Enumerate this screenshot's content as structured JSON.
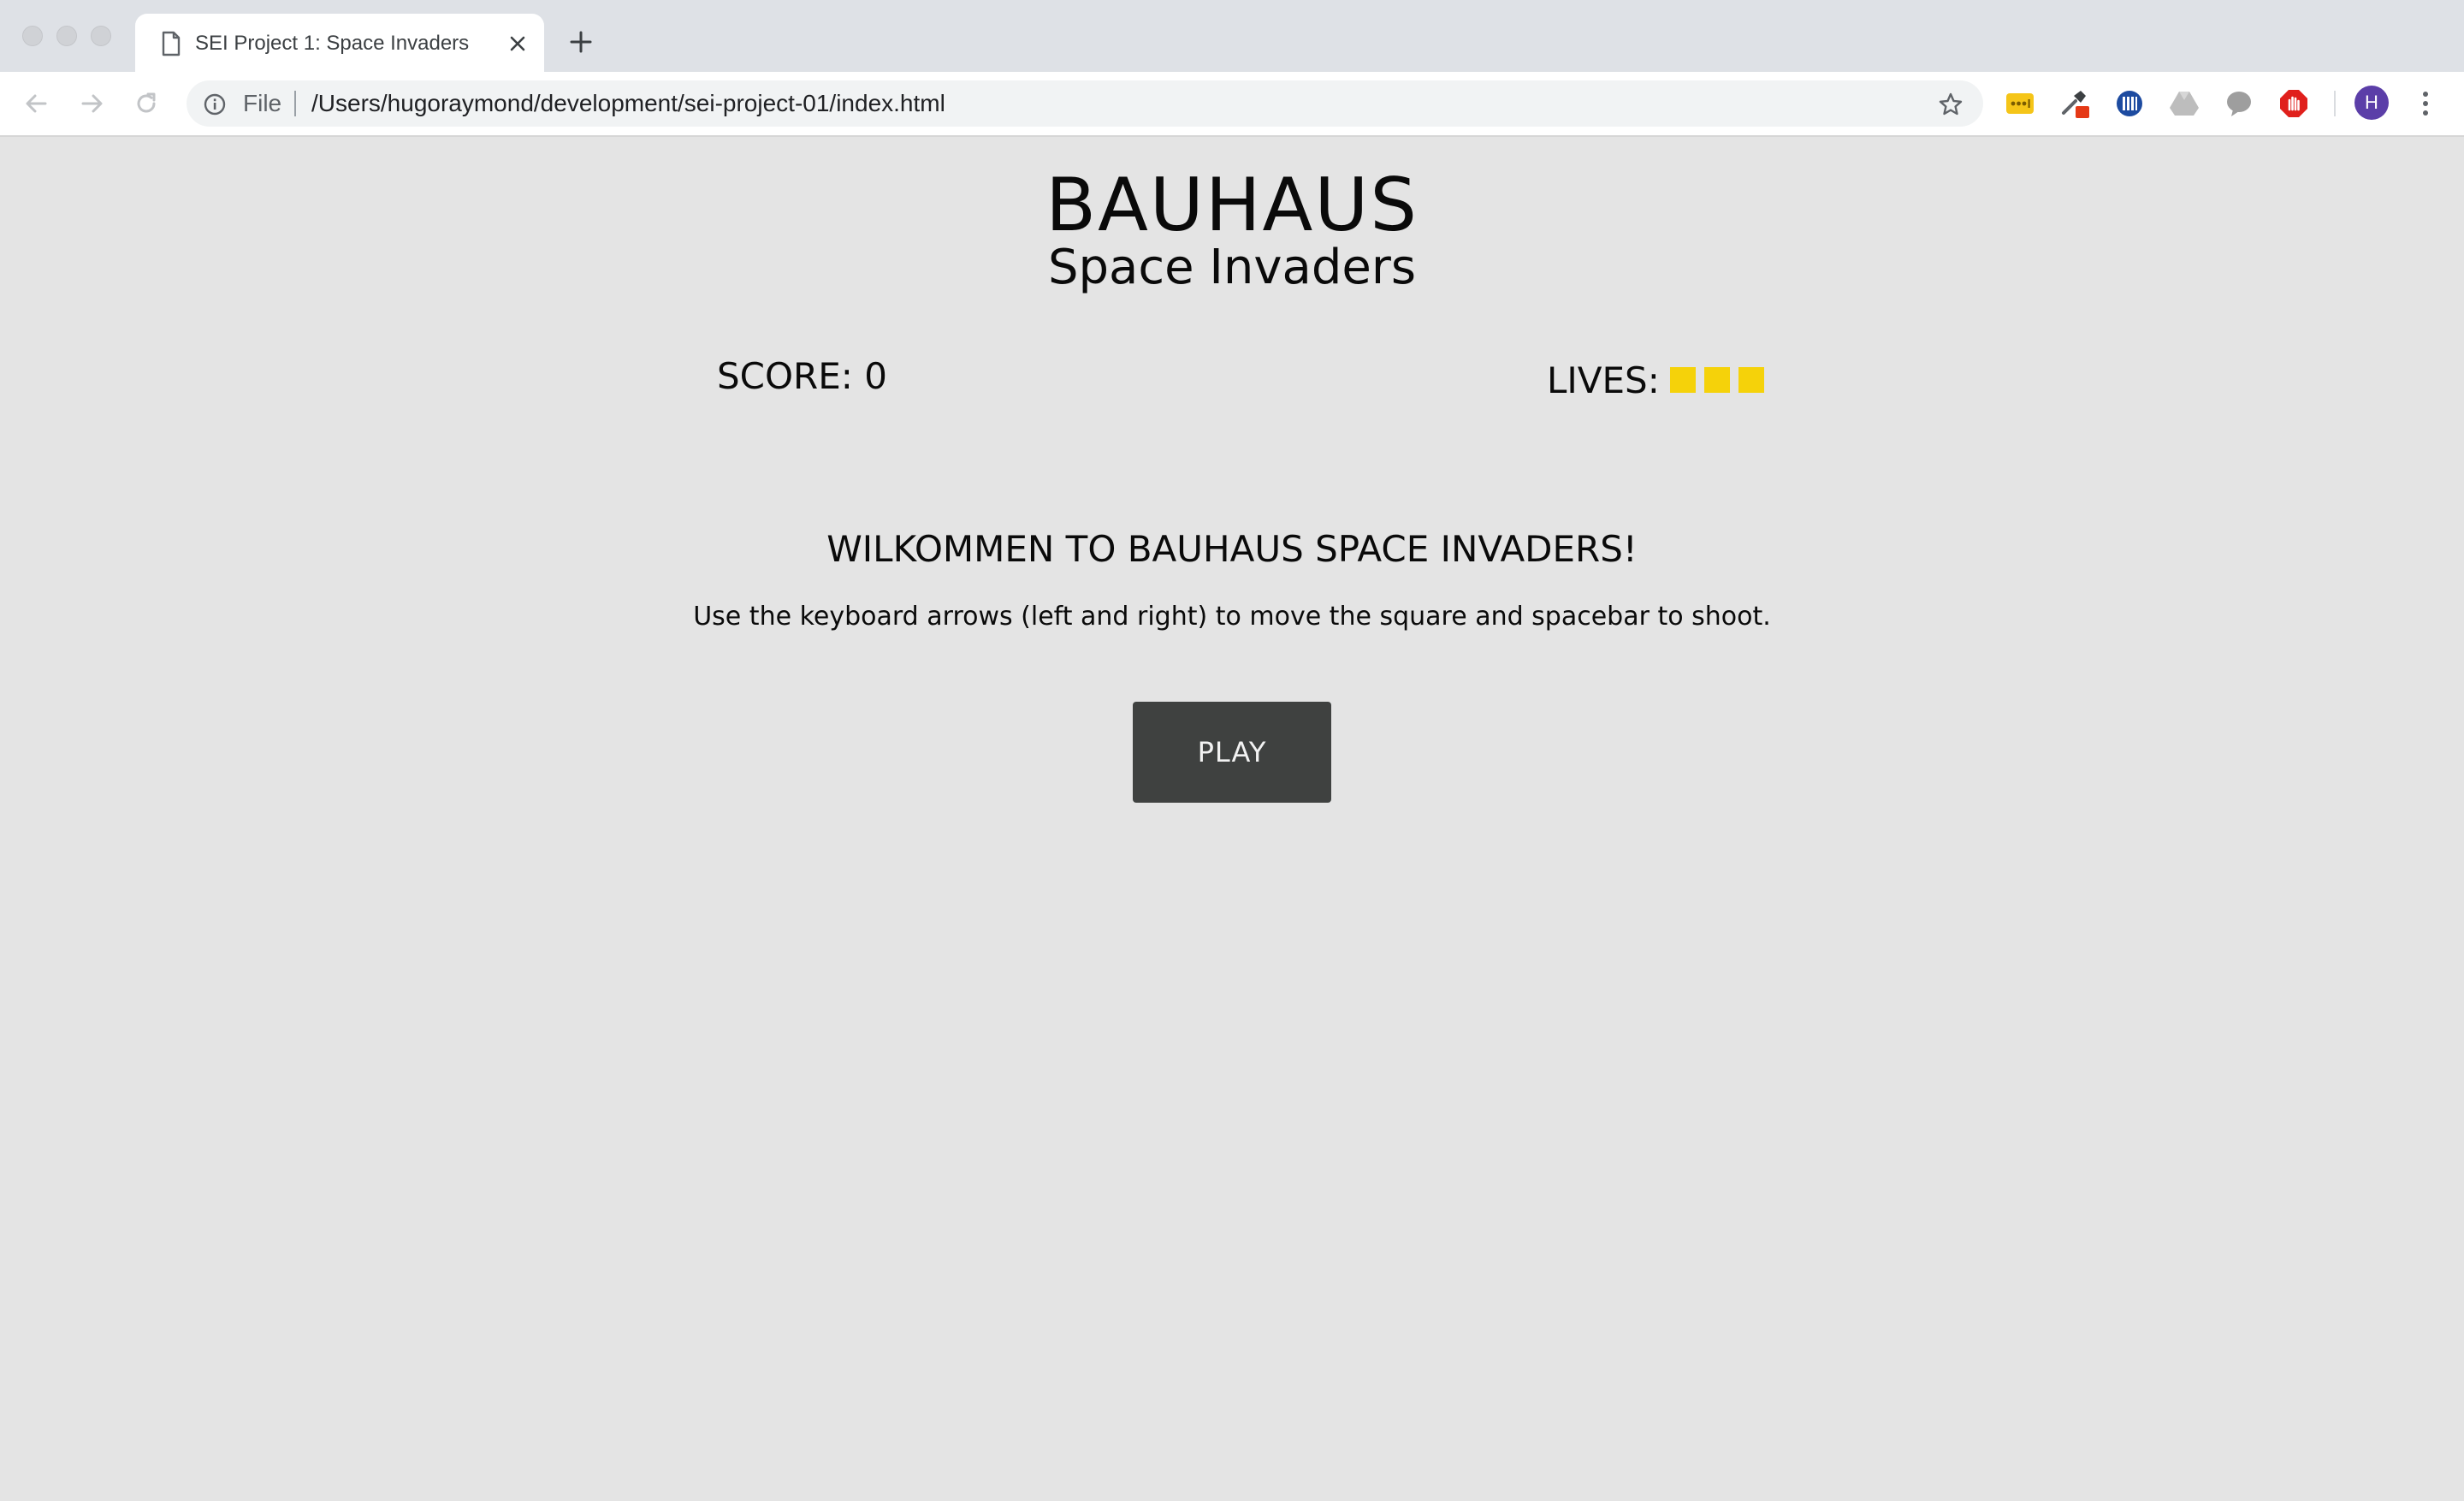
{
  "browser": {
    "tab": {
      "title": "SEI Project 1: Space Invaders"
    },
    "omnibox": {
      "scheme_label": "File",
      "url": "/Users/hugoraymond/development/sei-project-01/index.html"
    },
    "profile": {
      "initial": "H",
      "color": "#5b3ea8"
    },
    "extensions": [
      "lastpass-icon",
      "eyedropper-icon",
      "bars-icon",
      "google-drive-icon",
      "chat-bubble-icon",
      "adblock-icon"
    ]
  },
  "game": {
    "title": "BAUHAUS",
    "subtitle": "Space Invaders",
    "score_label": "SCORE: 0",
    "lives_label": "LIVES:",
    "lives": 3,
    "life_color": "#f5d20a",
    "welcome": "WILKOMMEN TO BAUHAUS SPACE INVADERS!",
    "instructions": "Use the keyboard arrows (left and right) to move the square and spacebar to shoot.",
    "play_label": "PLAY",
    "button_color": "#3f4140",
    "background_color": "#e4e4e4"
  }
}
